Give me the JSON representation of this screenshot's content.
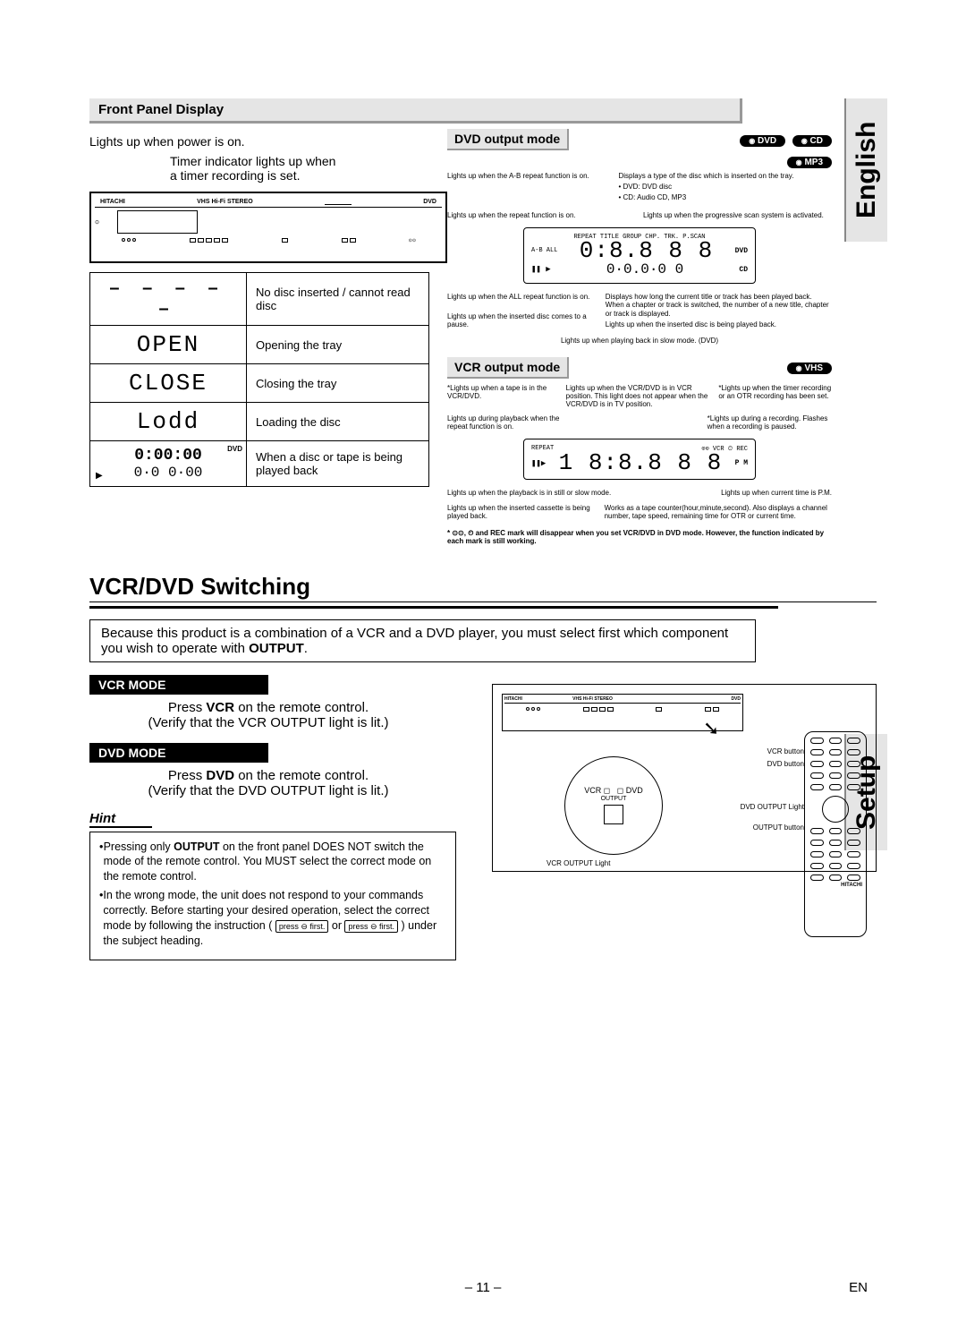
{
  "side_tabs": {
    "english": "English",
    "setup": "Setup"
  },
  "front_panel_heading": "Front Panel Display",
  "power_label": "Lights up when power is on.",
  "timer_label_1": "Timer indicator lights up when",
  "timer_label_2": "a timer recording is set.",
  "device_brand": "HITACHI",
  "device_tagline": "VHS Hi-Fi STEREO",
  "device_dvd_logo": "DVD",
  "state_table": [
    {
      "display": "– – – – –",
      "desc": "No disc inserted / cannot read disc",
      "dots": true
    },
    {
      "display": "OPEN",
      "desc": "Opening the tray"
    },
    {
      "display": "CLOSE",
      "desc": "Closing the tray"
    },
    {
      "display": "Lodd",
      "desc": "Loading the disc"
    },
    {
      "display": "0:00:00",
      "display2": "0·0 0·00",
      "badge": "DVD",
      "desc": "When a disc or tape is being played back",
      "play_icon": true
    }
  ],
  "dvd_output_heading": "DVD output mode",
  "dvd_pills": {
    "dvd": "DVD",
    "cd": "CD",
    "mp3": "MP3"
  },
  "dvd_callouts": {
    "ab": "Lights up when the A-B repeat function is on.",
    "disc_type": "Displays a type of the disc which is inserted on the tray.",
    "disc_type_list1": "• DVD: DVD disc",
    "disc_type_list2": "• CD: Audio CD, MP3",
    "repeat": "Lights up when the repeat function is on.",
    "pscan": "Lights up when the progressive scan system is activated.",
    "all_repeat": "Lights up when the ALL repeat function is on.",
    "time": "Displays how long the current title or track has been played back. When a chapter or track is switched, the number of a new title, chapter or track is displayed.",
    "pause": "Lights up when the inserted disc comes to a pause.",
    "playback": "Lights up when the inserted disc is being played back.",
    "slow": "Lights up when playing back in slow mode. (DVD)"
  },
  "dvd_lcd": {
    "top_labels": "REPEAT   TITLE GROUP   CHP. TRK.   P.SCAN",
    "side_labels_left": "A-B  ALL",
    "side_right_top": "DVD",
    "side_right_bottom": "CD",
    "digits": "0:8.8 8 8",
    "sub_digits": "0·0.0·0 0",
    "play_pause": "❚❚ ▶"
  },
  "vcr_output_heading": "VCR output mode",
  "vhs_pill": "VHS",
  "vcr_callouts": {
    "tape_in": "*Lights up when a tape is in the VCR/DVD.",
    "vcr_pos": "Lights up when the VCR/DVD is in VCR position. This light does not appear when the VCR/DVD is in TV position.",
    "timer_rec": "*Lights up when the timer recording or an OTR recording has been set.",
    "repeat_on": "Lights up during playback when the repeat function is on.",
    "rec": "*Lights up during a recording. Flashes when a recording is paused.",
    "still": "Lights up when the playback is in still or slow mode.",
    "pm": "Lights up when current time is P.M.",
    "cassette": "Lights up when the inserted cassette is being played back.",
    "counter": "Works as a tape counter(hour,minute,second). Also displays a channel number, tape speed, remaining time for OTR or current time."
  },
  "vcr_lcd": {
    "top_labels": "⊙⊙        VCR  ⏲  REC",
    "top_left": "REPEAT",
    "digits": "1 8:8.8 8 8",
    "pm": "P M",
    "play_pause": "❚❚▶"
  },
  "vcr_note": "⊙⊙, ⏲ and REC mark will disappear when you set VCR/DVD in DVD mode. However, the function indicated by each mark is still working.",
  "switching_heading": "VCR/DVD Switching",
  "intro": "Because this product is a combination of a VCR and a DVD player, you must select first which component you wish to operate with OUTPUT.",
  "vcr_mode_title": "VCR MODE",
  "vcr_mode_line1": "Press VCR on the remote control.",
  "vcr_mode_line2": "(Verify that the VCR OUTPUT light is lit.)",
  "dvd_mode_title": "DVD MODE",
  "dvd_mode_line1": "Press DVD on the remote control.",
  "dvd_mode_line2": "(Verify that the DVD OUTPUT light is lit.)",
  "hint_title": "Hint",
  "hint_bullets": [
    "Pressing only OUTPUT on the front panel DOES NOT switch the mode of the remote control. You MUST select the correct mode on the remote control.",
    "In the wrong mode, the unit does not respond to your commands correctly. Before starting your desired operation, select the correct mode by following the instruction (  press ⊖ first.  or  press ⊖ first.  ) under the subject heading."
  ],
  "diagram_labels": {
    "vcr_button": "VCR button",
    "dvd_button": "DVD button",
    "dvd_output_light": "DVD OUTPUT Light",
    "output_button": "OUTPUT button",
    "vcr_output_light": "VCR OUTPUT Light",
    "vcr_sq": "VCR ◻",
    "dvd_sq": "◻ DVD",
    "output": "OUTPUT"
  },
  "page_number": "– 11 –",
  "lang_code": "EN",
  "keycap_text": "press ⊖ first."
}
